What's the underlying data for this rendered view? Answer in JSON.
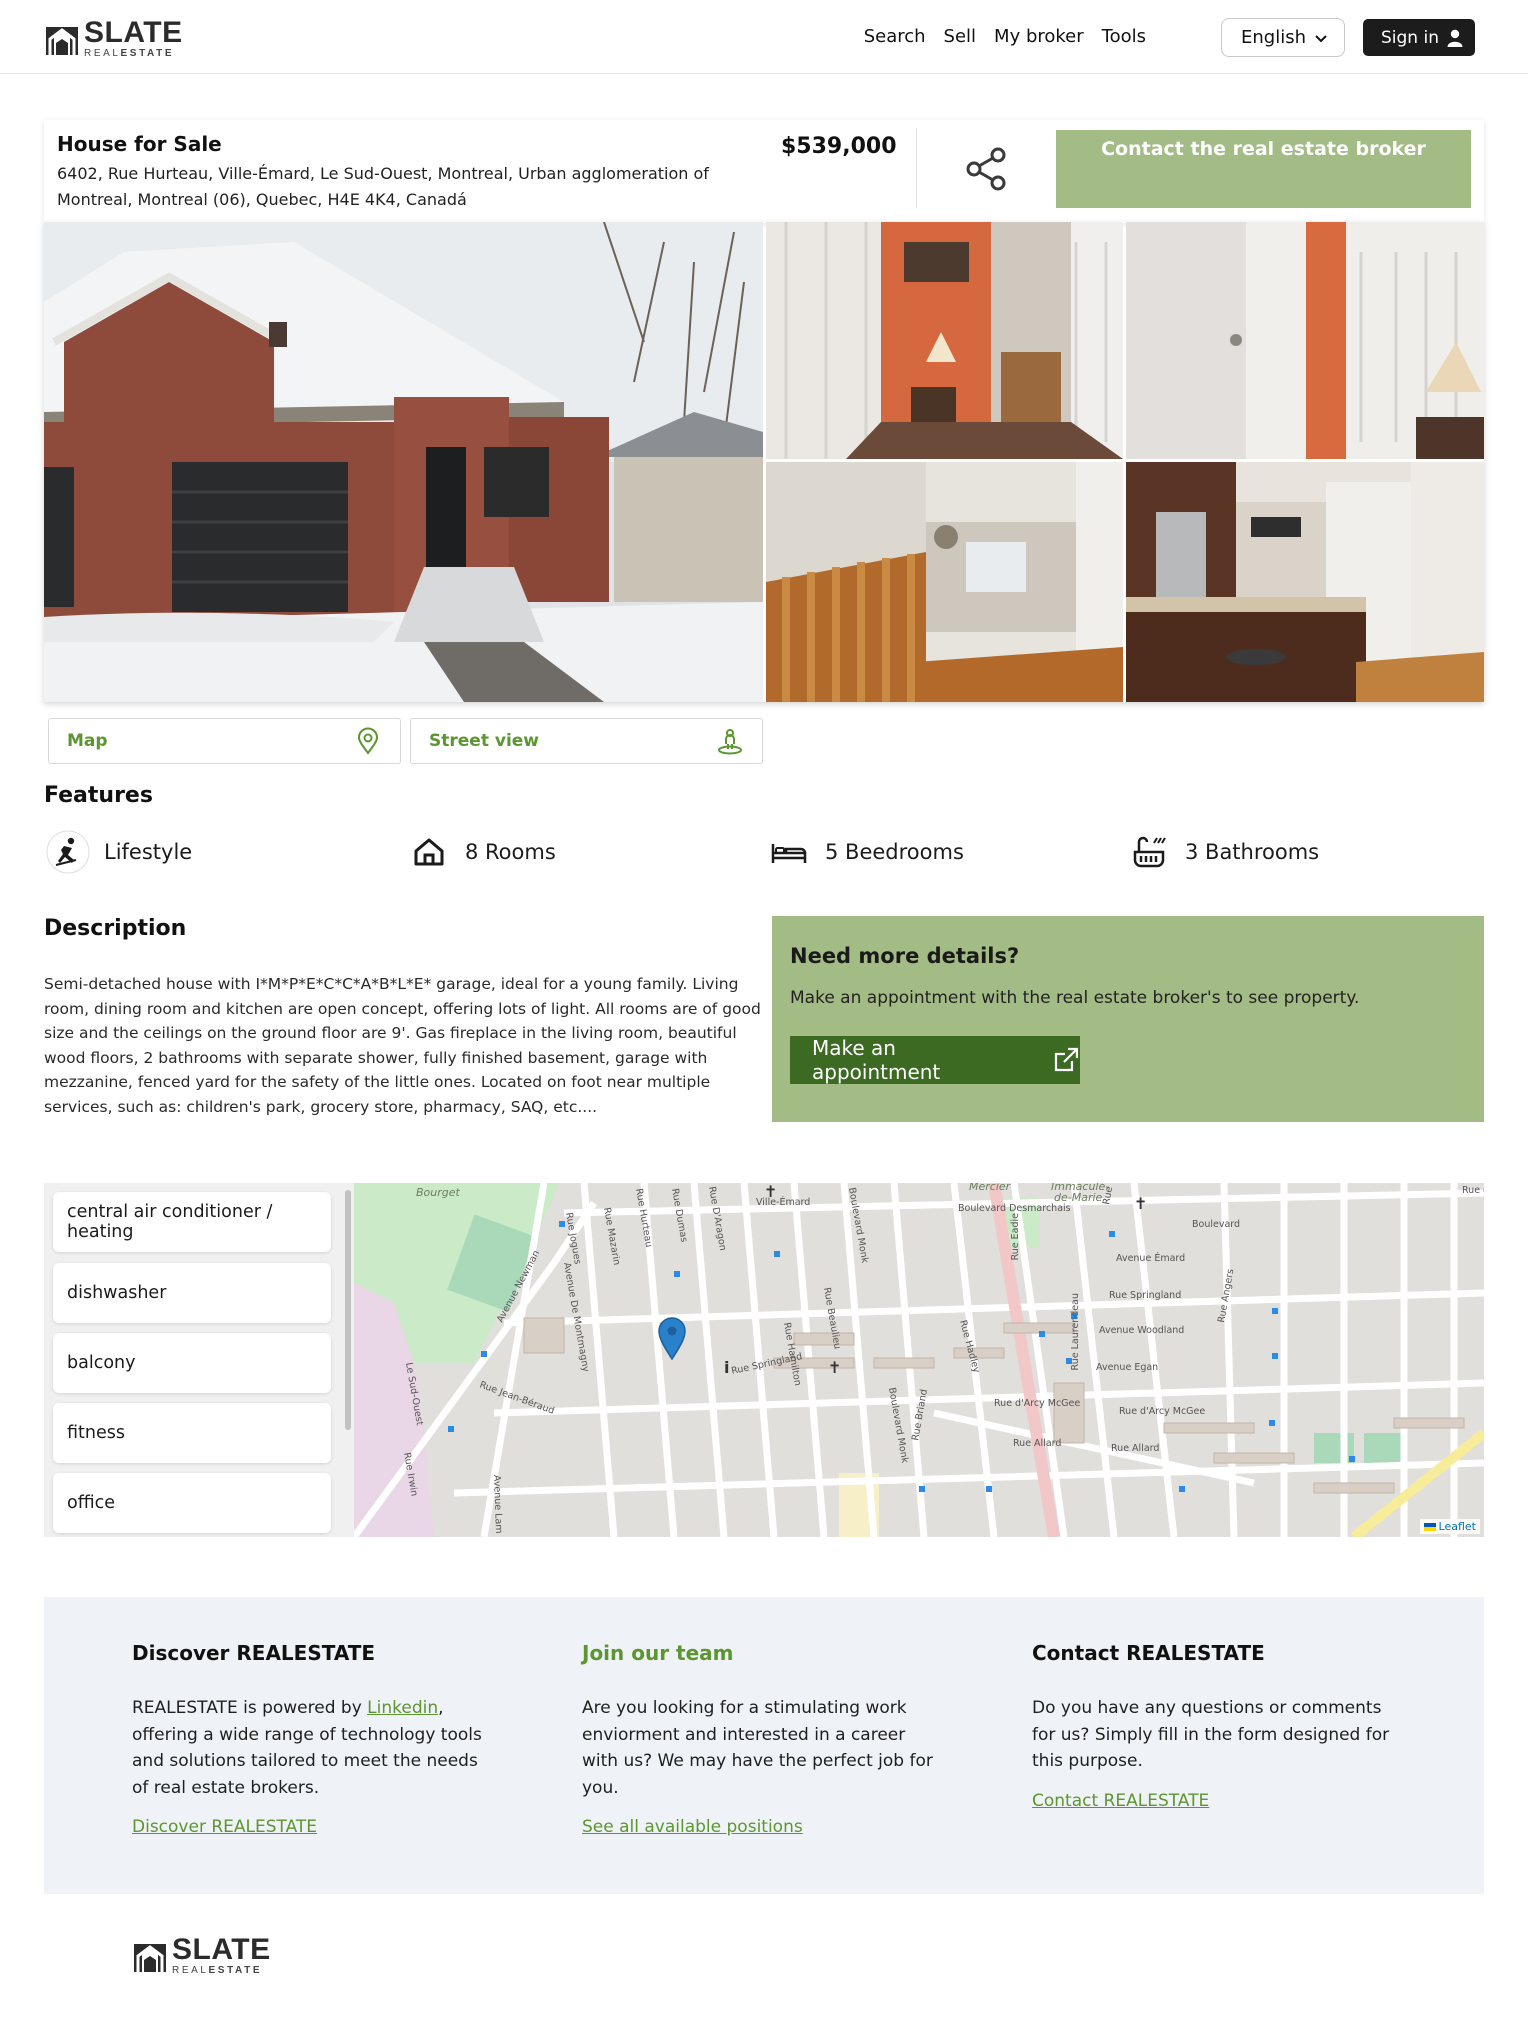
{
  "brand": {
    "name": "SLATE",
    "sub_part1": "REAL",
    "sub_part2": "ESTATE"
  },
  "header": {
    "nav": [
      "Search",
      "Sell",
      "My broker",
      "Tools"
    ],
    "language": "English",
    "signin_label": "Sign in"
  },
  "listing": {
    "type": "House for Sale",
    "address": "6402, Rue Hurteau, Ville-Émard, Le Sud-Ouest, Montreal, Urban agglomeration of Montreal, Montreal (06), Quebec, H4E 4K4, Canadá",
    "price": "$539,000",
    "contact_label": "Contact the real estate broker"
  },
  "views": {
    "map_label": "Map",
    "street_label": "Street view"
  },
  "features": {
    "title": "Features",
    "items": [
      {
        "icon": "lifestyle-icon",
        "label": "Lifestyle"
      },
      {
        "icon": "house-icon",
        "label": "8 Rooms"
      },
      {
        "icon": "bed-icon",
        "label": "5 Beedrooms"
      },
      {
        "icon": "shower-icon",
        "label": "3 Bathrooms"
      }
    ]
  },
  "description": {
    "title": "Description",
    "text": "Semi-detached house with I*M*P*E*C*C*A*B*L*E* garage, ideal for a young family. Living room, dining room and kitchen are open concept, offering lots of light. All rooms are of good size and the ceilings on the ground floor are 9'. Gas fireplace in the living room, beautiful wood floors, 2 bathrooms with separate shower, fully finished basement, garage with mezzanine, fenced yard for the safety of the little ones. Located on foot near multiple services, such as: children's park, grocery store, pharmacy, SAQ, etc...."
  },
  "details": {
    "title": "Need more details?",
    "text": "Make an appointment with the real estate broker's to see property.",
    "button_label": "Make an appointment"
  },
  "amenities": [
    "central air conditioner / heating",
    "dishwasher",
    "balcony",
    "fitness",
    "office"
  ],
  "map": {
    "labels": {
      "bourget": "Bourget",
      "mercier": "Mercier",
      "immacule_1": "Immaculé-",
      "immacule_2": "de-Marie",
      "ville_emard": "Ville-Émard",
      "sud_ouest": "Le Sud-Ouest",
      "blvd_desmarchais": "Boulevard Desmarchais",
      "boulevard": "Boulevard",
      "rue_d": "Rue d",
      "avenue_emard": "Avenue Émard",
      "rue_springland": "Rue Springland",
      "avenue_woodland": "Avenue Woodland",
      "avenue_egan": "Avenue Egan",
      "rue_darcy_mcgee": "Rue d'Arcy McGee",
      "rue_allard": "Rue Allard",
      "rue_jean_beraud": "Rue Jean-Béraud",
      "rue_springland_2": "Rue Springland",
      "avenue_newman": "Avenue Newman",
      "rue_irwin": "Rue Irwin",
      "avenue_lam": "Avenue Lam",
      "rue_jogues": "Rue Jogues",
      "rue_mazarin": "Rue Mazarin",
      "rue_hurteau": "Rue Hurteau",
      "rue_dumas": "Rue Dumas",
      "rue_daragon": "Rue D'Aragon",
      "rue_hamilton": "Rue Hamilton",
      "rue_beaulieu": "Rue Beaulieu",
      "blvd_monk": "Boulevard Monk",
      "rue_eadie": "Rue Eadie",
      "rue_laurendeau": "Rue Laurendeau",
      "rue_hadley": "Rue Hadley",
      "rue_briand": "Rue Briand",
      "rue_angers": "Rue Angers",
      "avenue_de_montmagny": "Avenue De Montmagny",
      "rue": "Rue"
    },
    "attribution": "Leaflet"
  },
  "footer": {
    "discover": {
      "title": "Discover REALESTATE",
      "text_before": "REALESTATE is powered by ",
      "link_inline": "Linkedin",
      "text_after": ", offering a wide range of technology tools and solutions tailored to meet the needs of real estate brokers.",
      "link": "Discover REALESTATE"
    },
    "join": {
      "title": "Join our team",
      "text": "Are you looking for a stimulating work enviorment and interested in a career with us? We may have the perfect job for you.",
      "link": "See all available positions"
    },
    "contact": {
      "title": "Contact REALESTATE",
      "text": "Do you have any questions or comments for us? Simply fill in the form designed for this purpose.",
      "link": "Contact REALESTATE"
    }
  },
  "colors": {
    "accent_green": "#5c9630",
    "panel_green": "#a3bb85",
    "button_dark_green": "#3d6a23",
    "footer_bg": "#eff2f6",
    "dark": "#1c1c1c"
  }
}
